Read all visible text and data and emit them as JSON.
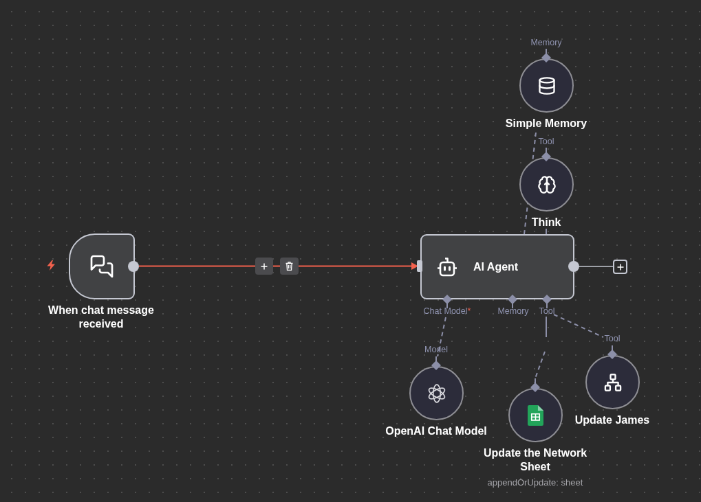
{
  "nodes": [
    {
      "kind": "trigger",
      "name": "When chat message received"
    },
    {
      "kind": "agent",
      "name": "AI Agent",
      "inputs": [
        {
          "label": "Chat Model",
          "required_mark": "*"
        },
        {
          "label": "Memory"
        },
        {
          "label": "Tool"
        }
      ]
    },
    {
      "kind": "memory",
      "name": "Simple Memory",
      "output_label": "Memory"
    },
    {
      "kind": "think",
      "name": "Think",
      "output_label": "Tool"
    },
    {
      "kind": "model",
      "name": "OpenAI Chat Model",
      "output_label": "Model"
    },
    {
      "kind": "sheets",
      "name": "Update the Network Sheet",
      "subtitle": "appendOrUpdate: sheet"
    },
    {
      "kind": "workflow",
      "name": "Update James",
      "output_label": "Tool"
    }
  ],
  "main_connection": {
    "highlighted": true
  }
}
